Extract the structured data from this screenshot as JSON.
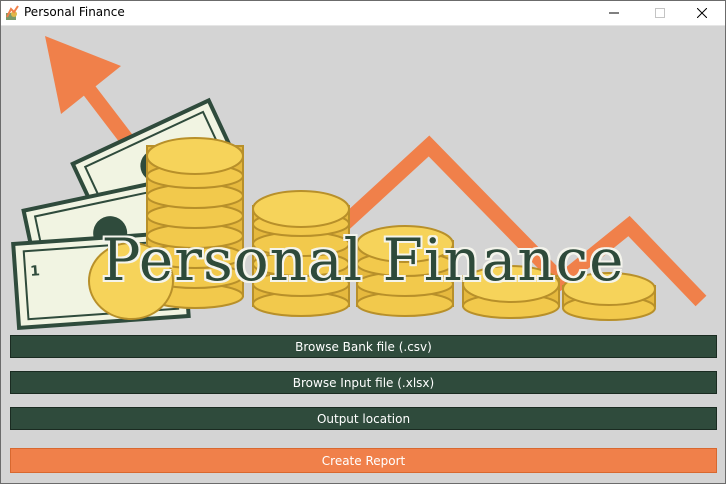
{
  "window": {
    "title": "Personal Finance",
    "icon": "finance-app-icon"
  },
  "banner": {
    "title": "Personal Finance"
  },
  "buttons": {
    "browse_bank": "Browse Bank file (.csv)",
    "browse_input": "Browse Input file (.xlsx)",
    "output_location": "Output location",
    "create_report": "Create Report"
  },
  "colors": {
    "button_dark": "#2f4b3c",
    "button_accent": "#f0804a",
    "background": "#d4d4d4"
  }
}
